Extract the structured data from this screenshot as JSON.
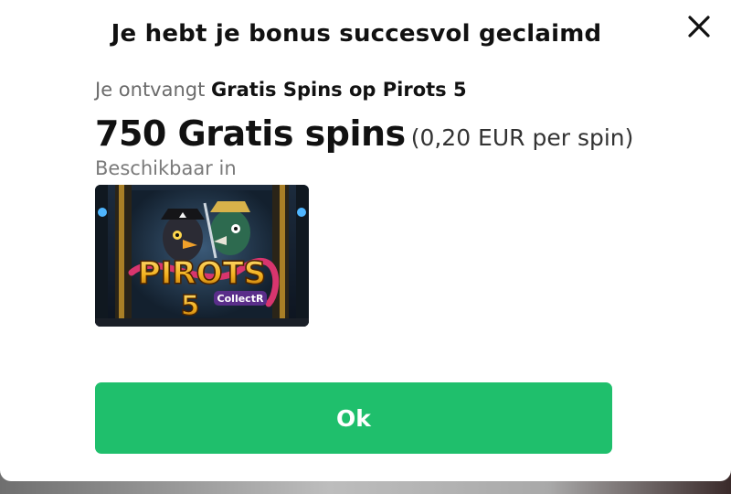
{
  "modal": {
    "title": "Je hebt je bonus succesvol geclaimd",
    "close_icon": "close-icon",
    "receive_prefix": "Je ontvangt",
    "receive_offer": "Gratis Spins op Pirots 5",
    "spins_amount": "750 Gratis spins",
    "spin_value": "(0,20 EUR per spin)",
    "available_label": "Beschikbaar in",
    "game": {
      "logo_title": "PIROTS",
      "logo_number": "5",
      "logo_badge": "CollectR"
    },
    "ok_label": "Ok"
  },
  "colors": {
    "accent": "#1fbf6c",
    "text": "#111111",
    "muted": "#6b6b6b"
  }
}
